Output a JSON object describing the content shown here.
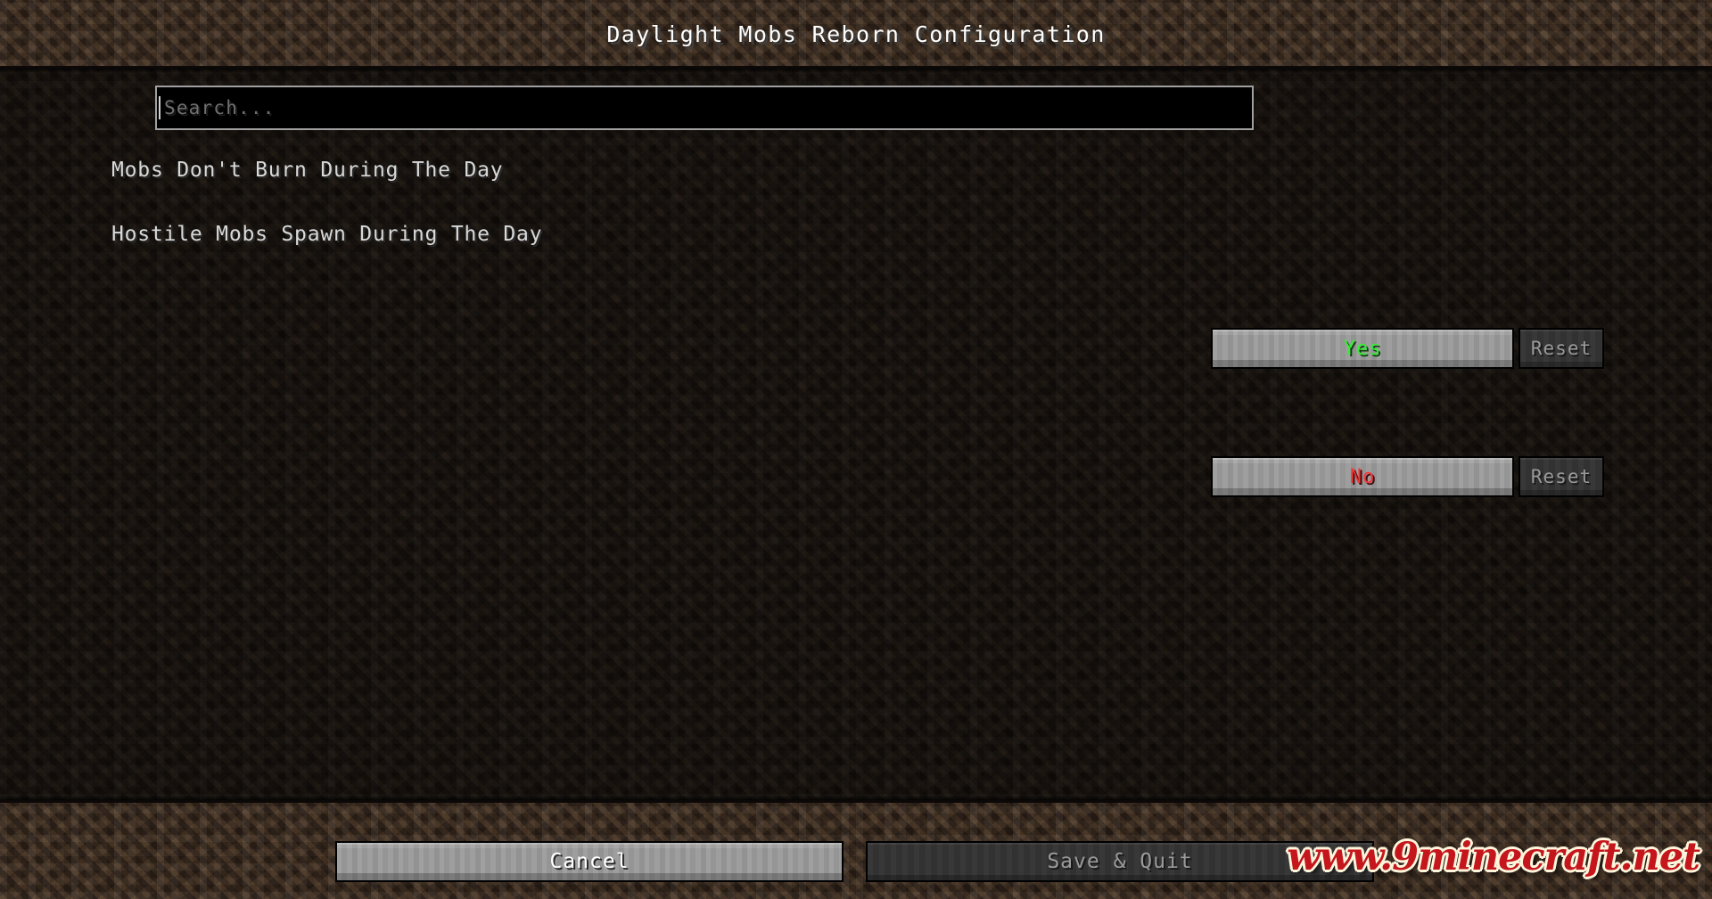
{
  "window": {
    "title": "Daylight Mobs Reborn Configuration"
  },
  "search": {
    "value": "",
    "placeholder": "Search..."
  },
  "options": [
    {
      "label": "Mobs Don't Burn During The Day",
      "value": "Yes",
      "value_state": "yes",
      "value_color": "#33ef33",
      "reset_label": "Reset",
      "reset_enabled": false
    },
    {
      "label": "Hostile Mobs Spawn During The Day",
      "value": "No",
      "value_state": "no",
      "value_color": "#f3373a",
      "reset_label": "Reset",
      "reset_enabled": false
    }
  ],
  "footer": {
    "cancel_label": "Cancel",
    "save_label": "Save & Quit",
    "save_enabled": false
  },
  "watermark": {
    "text": "www.9minecraft.net",
    "color": "#c4161c",
    "outline_color": "#fdf6dd"
  },
  "theme": {
    "background": "#39291d",
    "body_background": "#1a1310",
    "button_enabled": "#9b9b9b",
    "button_disabled": "#333333",
    "text": "#ffffff",
    "placeholder_text": "#707070"
  }
}
